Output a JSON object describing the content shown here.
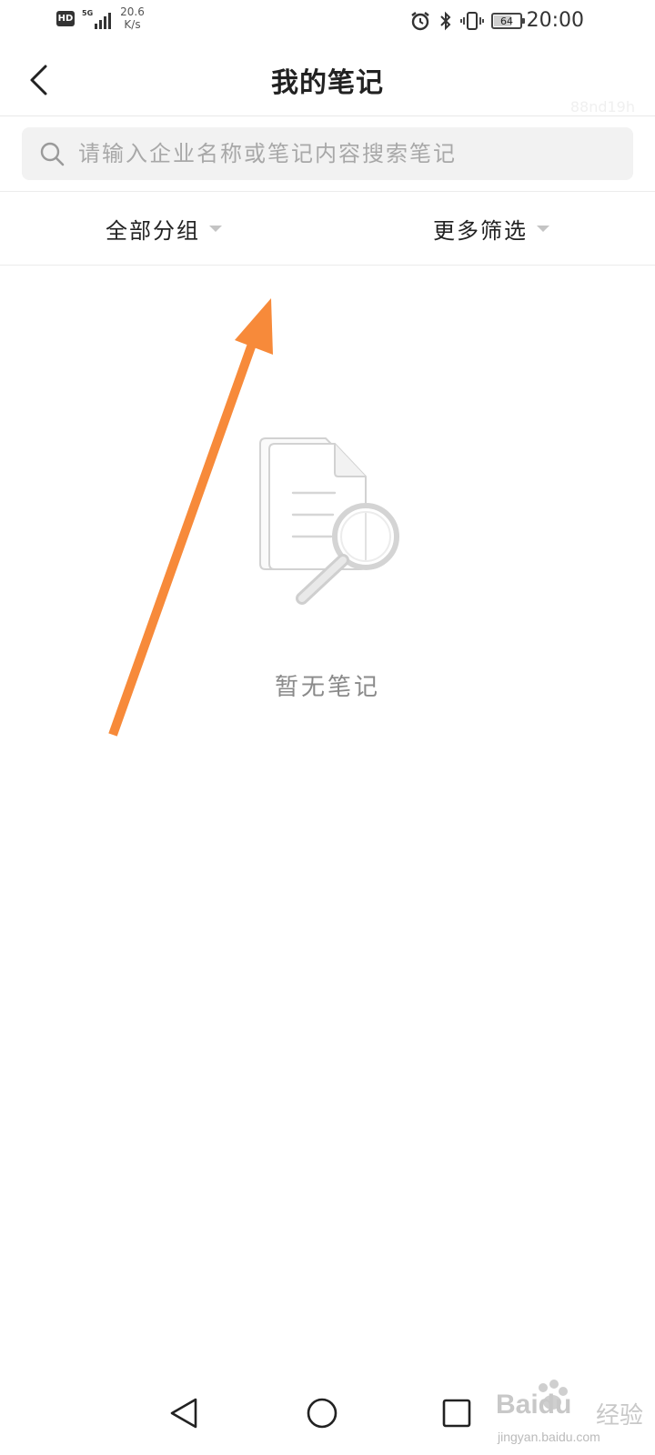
{
  "status_bar": {
    "hd": "HD",
    "network": "5G",
    "speed_value": "20.6",
    "speed_unit": "K/s",
    "battery": "64",
    "battery_level": 0.64,
    "time": "20:00"
  },
  "nav": {
    "title": "我的笔记",
    "overlay_id": "88nd19h"
  },
  "search": {
    "placeholder": "请输入企业名称或笔记内容搜索笔记"
  },
  "filters": [
    {
      "label": "全部分组"
    },
    {
      "label": "更多筛选"
    }
  ],
  "empty_state": {
    "message": "暂无笔记"
  },
  "annotation": {
    "color": "#f78a3a"
  },
  "watermark": {
    "brand": "Baidu",
    "brand_cn": "经验",
    "url": "jingyan.baidu.com"
  }
}
